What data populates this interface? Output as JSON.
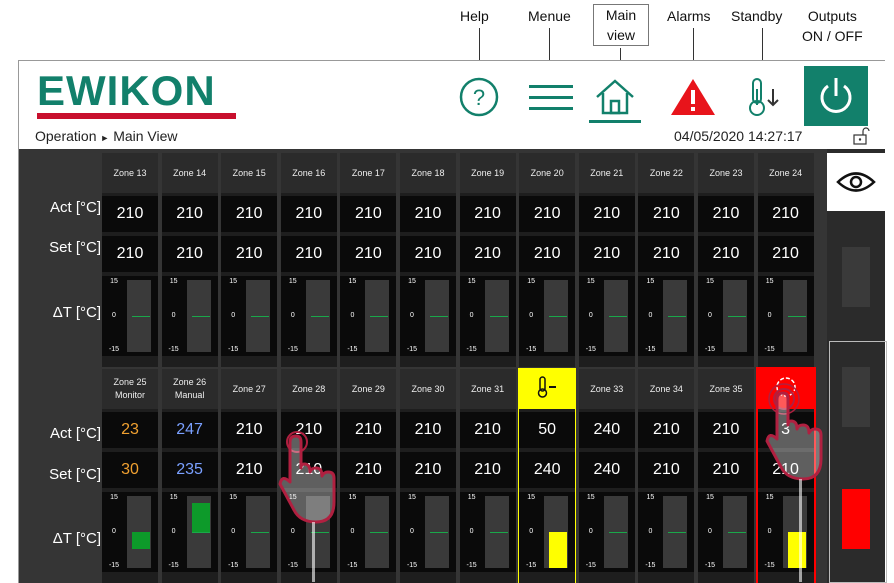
{
  "callouts": {
    "help": "Help",
    "menue": "Menue",
    "main_view_line1": "Main",
    "main_view_line2": "view",
    "alarms": "Alarms",
    "standby": "Standby",
    "outputs_line1": "Outputs",
    "outputs_line2": "ON / OFF"
  },
  "brand": {
    "name": "EWIKON",
    "color": "#12806b",
    "bar_color": "#c8102e"
  },
  "breadcrumb": {
    "section": "Operation",
    "separator": "►",
    "page": "Main View"
  },
  "datetime": "04/05/2020 14:27:17",
  "header_icons": [
    "help-icon",
    "menu-icon",
    "home-icon",
    "alarm-icon",
    "standby-icon",
    "power-icon"
  ],
  "labels": {
    "act": "Act [°C]",
    "set": "Set [°C]",
    "dt": "ΔT [°C]"
  },
  "scale": {
    "max": "15",
    "zero": "0",
    "min": "-15"
  },
  "row1": [
    {
      "name": "Zone 13",
      "act": "210",
      "set": "210",
      "dt": 0
    },
    {
      "name": "Zone 14",
      "act": "210",
      "set": "210",
      "dt": 0
    },
    {
      "name": "Zone 15",
      "act": "210",
      "set": "210",
      "dt": 0
    },
    {
      "name": "Zone 16",
      "act": "210",
      "set": "210",
      "dt": 0
    },
    {
      "name": "Zone 17",
      "act": "210",
      "set": "210",
      "dt": 0
    },
    {
      "name": "Zone 18",
      "act": "210",
      "set": "210",
      "dt": 0
    },
    {
      "name": "Zone 19",
      "act": "210",
      "set": "210",
      "dt": 0
    },
    {
      "name": "Zone 20",
      "act": "210",
      "set": "210",
      "dt": 0
    },
    {
      "name": "Zone 21",
      "act": "210",
      "set": "210",
      "dt": 0
    },
    {
      "name": "Zone 22",
      "act": "210",
      "set": "210",
      "dt": 0
    },
    {
      "name": "Zone 23",
      "act": "210",
      "set": "210",
      "dt": 0
    },
    {
      "name": "Zone 24",
      "act": "210",
      "set": "210",
      "dt": 0
    }
  ],
  "row2": [
    {
      "name": "Zone 25",
      "sub": "Monitor",
      "act": "23",
      "set": "30",
      "dt": -7,
      "color": "#f0a030",
      "fill": "#0d9a2a"
    },
    {
      "name": "Zone 26",
      "sub": "Manual",
      "act": "247",
      "set": "235",
      "dt": 12,
      "color": "#7aa0ff",
      "fill": "#0d9a2a"
    },
    {
      "name": "Zone 27",
      "act": "210",
      "set": "210",
      "dt": 0
    },
    {
      "name": "Zone 28",
      "act": "210",
      "set": "210",
      "dt": 0
    },
    {
      "name": "Zone 29",
      "act": "210",
      "set": "210",
      "dt": 0
    },
    {
      "name": "Zone 30",
      "act": "210",
      "set": "210",
      "dt": 0
    },
    {
      "name": "Zone 31",
      "act": "210",
      "set": "210",
      "dt": 0
    },
    {
      "name": "",
      "icon": "thermo-down-icon",
      "act": "50",
      "set": "240",
      "dt": -15,
      "state": "standby",
      "fill": "#ffff00"
    },
    {
      "name": "Zone 33",
      "act": "240",
      "set": "240",
      "dt": 0
    },
    {
      "name": "Zone 34",
      "act": "210",
      "set": "210",
      "dt": 0
    },
    {
      "name": "Zone 35",
      "act": "210",
      "set": "210",
      "dt": 0
    },
    {
      "name": "",
      "icon": "alarm-icon",
      "act": "3",
      "set": "210",
      "dt": -15,
      "state": "alarm",
      "fill": "#ffff00"
    }
  ]
}
